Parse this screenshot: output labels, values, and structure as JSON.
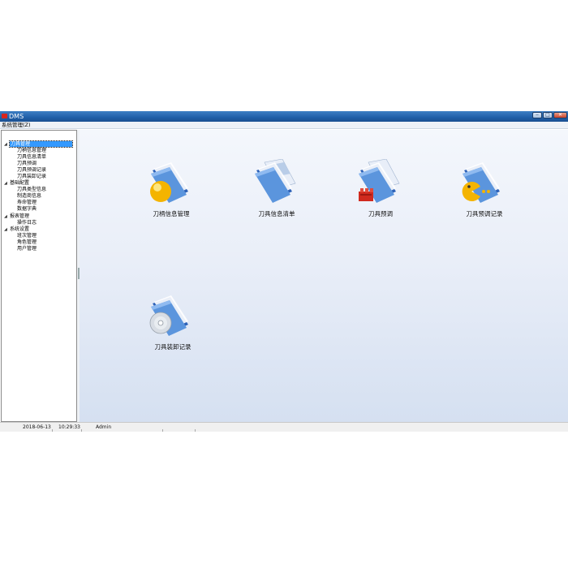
{
  "window": {
    "title": "DMS",
    "controls": {
      "minimize": "‒",
      "maximize": "□",
      "close": "✕"
    }
  },
  "menubar": {
    "items": [
      {
        "label": "系统管理(Z)"
      }
    ]
  },
  "tree": {
    "groups": [
      {
        "label": "刀具管理",
        "toggle": "◢",
        "selected": true,
        "children": [
          "刀柄信息管理",
          "刀具信息清单",
          "刀具预调",
          "刀具预调记录",
          "刀具装卸记录"
        ]
      },
      {
        "label": "基础配置",
        "toggle": "◢",
        "children": [
          "刀具类型信息",
          "制造商信息",
          "寿命管理",
          "数据字典"
        ]
      },
      {
        "label": "报表管理",
        "toggle": "◢",
        "children": [
          "操作日志"
        ]
      },
      {
        "label": "系统设置",
        "toggle": "◢",
        "children": [
          "班次管理",
          "角色管理",
          "用户管理"
        ]
      }
    ]
  },
  "tiles": [
    {
      "label": "刀柄信息管理",
      "icon": "folder-yellow-ball-icon"
    },
    {
      "label": "刀具信息清单",
      "icon": "folder-documents-icon"
    },
    {
      "label": "刀具预调",
      "icon": "folder-red-blocks-icon"
    },
    {
      "label": "刀具预调记录",
      "icon": "folder-pacman-icon"
    },
    {
      "label": "刀具装卸记录",
      "icon": "folder-disc-icon"
    }
  ],
  "statusbar": {
    "date": "2018-06-13",
    "time": "10:29:33",
    "user": "Admin"
  },
  "colors": {
    "titlebar": "#1f5fa8",
    "selection": "#3399ff",
    "folder": "#4a86d4"
  }
}
